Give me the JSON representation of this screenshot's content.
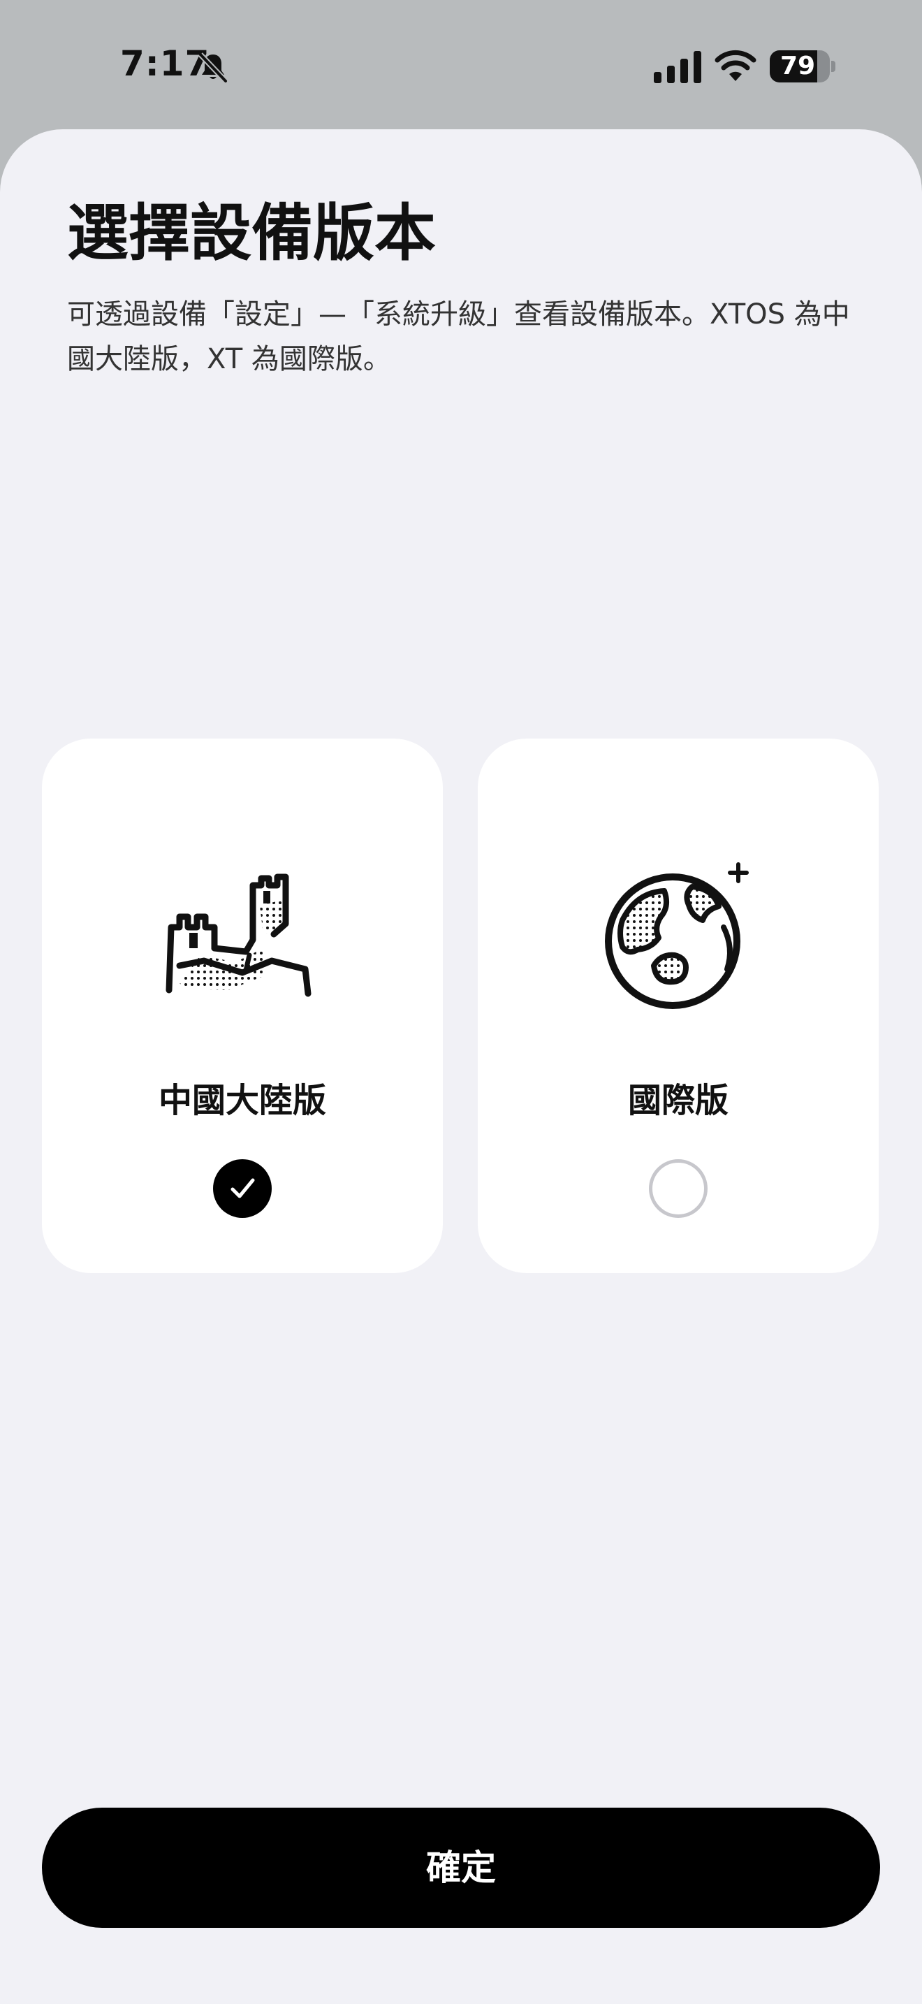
{
  "status_bar": {
    "time": "7:17",
    "battery_percent": 79,
    "battery_label": "79",
    "icons": [
      "bell-slash-icon",
      "cellular-signal-icon",
      "wifi-icon",
      "battery-icon"
    ]
  },
  "header": {
    "title": "選擇設備版本",
    "description": "可透過設備「設定」—「系統升級」查看設備版本。XTOS 為中國大陸版，XT 為國際版。"
  },
  "options": [
    {
      "label": "中國大陸版",
      "icon": "great-wall-icon",
      "selected": true
    },
    {
      "label": "國際版",
      "icon": "globe-icon",
      "selected": false
    }
  ],
  "confirm_button": {
    "label": "確定"
  },
  "colors": {
    "status_bar_bg": "#b8bbbd",
    "sheet_bg": "#f1f1f6",
    "card_bg": "#ffffff",
    "primary": "#000000",
    "radio_unselected_border": "#c7c7cc"
  }
}
